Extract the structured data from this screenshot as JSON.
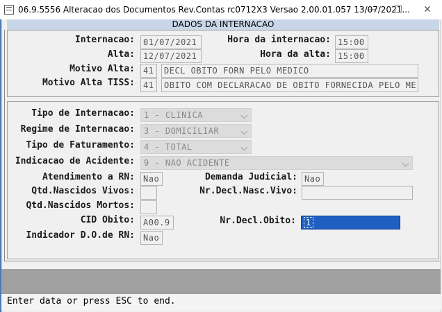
{
  "window": {
    "title": "06.9.5556  Alteracao dos Documentos Rev.Contas rc0712X3 Versao 2.00.01.057 13/07/2021...",
    "minimize": "—",
    "maximize": "☐",
    "close": "✕"
  },
  "section_header": "DADOS DA INTERNACAO",
  "panel1": {
    "internacao": {
      "label": "Internacao:",
      "value": "01/07/2021"
    },
    "hora_internacao": {
      "label": "Hora da internacao:",
      "value": "15:00"
    },
    "alta": {
      "label": "Alta:",
      "value": "12/07/2021"
    },
    "hora_alta": {
      "label": "Hora da alta:",
      "value": "15:00"
    },
    "motivo_alta": {
      "label": "Motivo Alta:",
      "code": "41",
      "desc": "DECL OBITO FORN PELO MEDICO"
    },
    "motivo_alta_tiss": {
      "label": "Motivo Alta TISS:",
      "code": "41",
      "desc": "OBITO COM DECLARACAO DE OBITO FORNECIDA PELO ME"
    }
  },
  "panel2": {
    "tipo_internacao": {
      "label": "Tipo de Internacao:",
      "value": "1 - CLINICA"
    },
    "regime_internacao": {
      "label": "Regime de Internacao:",
      "value": "3 - DOMICILIAR"
    },
    "tipo_faturamento": {
      "label": "Tipo de Faturamento:",
      "value": "4 - TOTAL"
    },
    "indicacao_acidente": {
      "label": "Indicacao de Acidente:",
      "value": "9 - NAO ACIDENTE"
    },
    "atendimento_rn": {
      "label": "Atendimento a RN:",
      "value": "Nao"
    },
    "demanda_judicial": {
      "label": "Demanda Judicial:",
      "value": "Nao"
    },
    "qtd_nascidos_vivos": {
      "label": "Qtd.Nascidos Vivos:",
      "value": ""
    },
    "nr_decl_nasc_vivo": {
      "label": "Nr.Decl.Nasc.Vivo:",
      "value": ""
    },
    "qtd_nascidos_mortos": {
      "label": "Qtd.Nascidos Mortos:",
      "value": ""
    },
    "cid_obito": {
      "label": "CID Obito:",
      "value": "A00.9"
    },
    "nr_decl_obito": {
      "label": "Nr.Decl.Obito:",
      "value": "1"
    },
    "indicador_do_rn": {
      "label": "Indicador D.O.de RN:",
      "value": "Nao"
    }
  },
  "status_message": "Enter data or press ESC to end."
}
